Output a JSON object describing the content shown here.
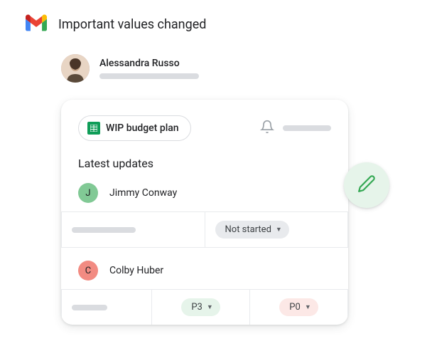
{
  "subject": "Important values changed",
  "sender": {
    "name": "Alessandra Russo"
  },
  "chip": {
    "label": "WIP budget plan"
  },
  "section_title": "Latest updates",
  "updates": [
    {
      "avatar_letter": "J",
      "name": "Jimmy Conway",
      "status": "Not started"
    },
    {
      "avatar_letter": "C",
      "name": "Colby Huber",
      "p3": "P3",
      "p0": "P0"
    }
  ]
}
